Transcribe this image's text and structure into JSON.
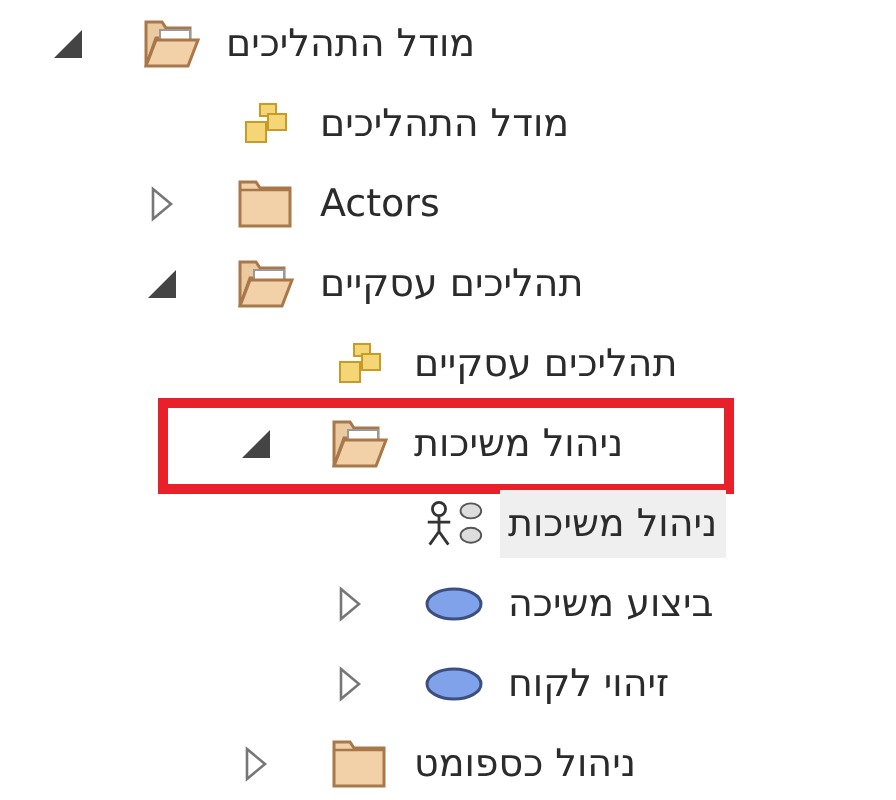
{
  "tree": {
    "items": [
      {
        "label": "מודל התהליכים",
        "kind": "folder",
        "expanded": true,
        "selected": false,
        "highlighted": false,
        "children": [
          {
            "label": "מודל התהליכים",
            "kind": "package",
            "selected": false,
            "highlighted": false
          },
          {
            "label": "Actors",
            "kind": "folder",
            "expanded": false,
            "selected": false,
            "highlighted": false
          },
          {
            "label": "תהליכים עסקיים",
            "kind": "folder",
            "expanded": true,
            "selected": false,
            "highlighted": false,
            "children": [
              {
                "label": "תהליכים עסקיים",
                "kind": "package",
                "selected": false,
                "highlighted": false
              },
              {
                "label": "ניהול משיכות",
                "kind": "folder",
                "expanded": true,
                "selected": false,
                "highlighted": true,
                "children": [
                  {
                    "label": "ניהול משיכות",
                    "kind": "diagram",
                    "selected": true,
                    "highlighted": false
                  },
                  {
                    "label": "ביצוע משיכה",
                    "kind": "usecase",
                    "expanded": false,
                    "selected": false,
                    "highlighted": false
                  },
                  {
                    "label": "זיהוי לקוח",
                    "kind": "usecase",
                    "expanded": false,
                    "selected": false,
                    "highlighted": false
                  }
                ]
              },
              {
                "label": "ניהול כספומט",
                "kind": "folder",
                "expanded": false,
                "selected": false,
                "highlighted": false
              }
            ]
          }
        ]
      }
    ]
  }
}
